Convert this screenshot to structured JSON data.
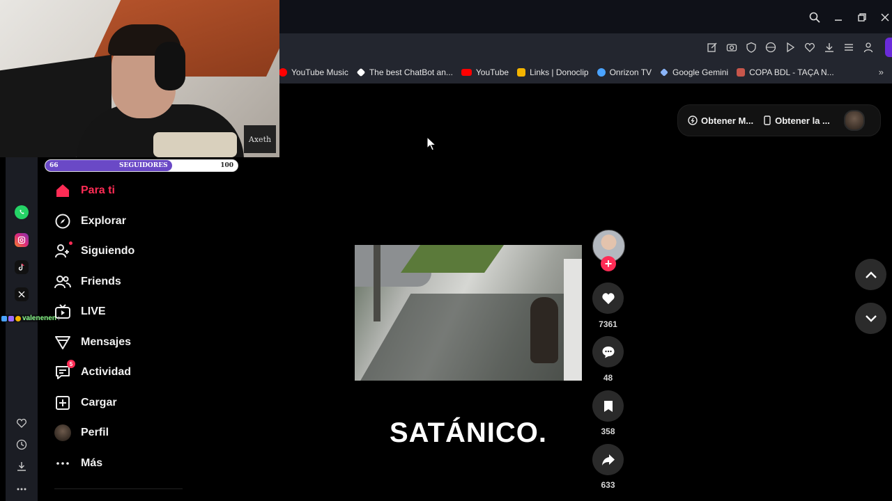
{
  "browser": {
    "bookmarks": [
      {
        "label": "YouTube Music",
        "icon": "youtube-music-icon",
        "color": "#ff0000"
      },
      {
        "label": "The best ChatBot an...",
        "icon": "chatbot-icon",
        "color": "#ffffff"
      },
      {
        "label": "YouTube",
        "icon": "youtube-icon",
        "color": "#ff0000"
      },
      {
        "label": "Links | Donoclip",
        "icon": "donoclip-icon",
        "color": "#f4b400"
      },
      {
        "label": "Onrizon TV",
        "icon": "onrizon-icon",
        "color": "#4aa3ff"
      },
      {
        "label": "Google Gemini",
        "icon": "gemini-icon",
        "color": "#8ab4f8"
      },
      {
        "label": "COPA BDL - TAÇA N...",
        "icon": "copa-icon",
        "color": "#c7564b"
      }
    ]
  },
  "overlay": {
    "webcam_logo": "Axeth",
    "followers": {
      "current": "66",
      "label": "SEGUIDORES",
      "goal": "100",
      "progress": 0.66
    },
    "chat": {
      "user": "valenenen",
      "message": ":"
    }
  },
  "nav": {
    "items": [
      {
        "label": "Para ti",
        "icon": "home-icon",
        "active": true
      },
      {
        "label": "Explorar",
        "icon": "compass-icon"
      },
      {
        "label": "Siguiendo",
        "icon": "following-icon"
      },
      {
        "label": "Friends",
        "icon": "friends-icon"
      },
      {
        "label": "LIVE",
        "icon": "live-icon"
      },
      {
        "label": "Mensajes",
        "icon": "messages-icon"
      },
      {
        "label": "Actividad",
        "icon": "activity-icon",
        "badge": "5"
      },
      {
        "label": "Cargar",
        "icon": "upload-icon"
      },
      {
        "label": "Perfil",
        "icon": "profile-avatar"
      },
      {
        "label": "Más",
        "icon": "more-icon"
      }
    ]
  },
  "top_actions": {
    "get_app": "Obtener M...",
    "get_desktop": "Obtener la ..."
  },
  "video": {
    "caption": "SATÁNICO.",
    "likes": "7361",
    "comments": "48",
    "saves": "358",
    "shares": "633"
  },
  "colors": {
    "accent": "#fe2c55",
    "background": "#000000",
    "follower_bar": "#6a49c6"
  }
}
